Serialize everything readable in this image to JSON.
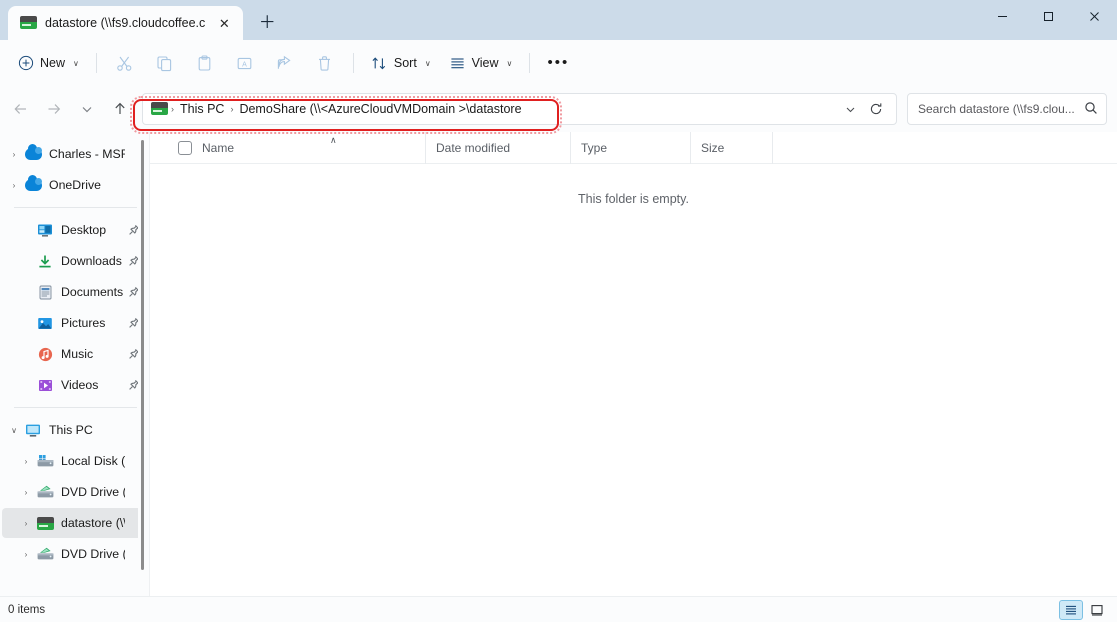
{
  "window": {
    "tab_title": "datastore (\\\\fs9.cloudcoffee.c",
    "tab_icon": "network-drive-icon",
    "close_tab_label": "✕",
    "new_tab_label": "＋",
    "minimize_label": "—",
    "maximize_label": "☐",
    "close_label": "✕"
  },
  "toolbar": {
    "new_label": "New",
    "new_chevron": "∨",
    "cut_label": "Cut",
    "copy_label": "Copy",
    "paste_label": "Paste",
    "rename_label": "Rename",
    "share_label": "Share",
    "delete_label": "Delete",
    "sort_label": "Sort",
    "sort_chevron": "∨",
    "view_label": "View",
    "view_chevron": "∨",
    "more_label": "•••"
  },
  "addressbar": {
    "back_label": "←",
    "forward_label": "→",
    "recent_label": "∨",
    "up_label": "↑",
    "breadcrumb_icon": "network-drive-icon",
    "crumbs": [
      {
        "label": "This PC"
      },
      {
        "label": "DemoShare (\\\\<AzureCloudVMDomain >\\datastore"
      }
    ],
    "separator": "›",
    "dropdown_label": "∨",
    "refresh_label": "↻",
    "search_placeholder": "Search datastore (\\\\fs9.clou...",
    "search_value": "",
    "search_icon": "search-icon",
    "annotation_color": "#e02020"
  },
  "sidebar": {
    "items": [
      {
        "label": "Charles - MSFT",
        "icon": "onedrive-cloud-icon",
        "expander": "›",
        "indent": 0,
        "pinned": false,
        "selected": false
      },
      {
        "label": "OneDrive",
        "icon": "onedrive-cloud-icon",
        "expander": "›",
        "indent": 0,
        "pinned": false,
        "selected": false
      },
      {
        "divider": true
      },
      {
        "label": "Desktop",
        "icon": "desktop-icon",
        "expander": "",
        "indent": 1,
        "pinned": true,
        "selected": false
      },
      {
        "label": "Downloads",
        "icon": "downloads-icon",
        "expander": "",
        "indent": 1,
        "pinned": true,
        "selected": false
      },
      {
        "label": "Documents",
        "icon": "documents-icon",
        "expander": "",
        "indent": 1,
        "pinned": true,
        "selected": false
      },
      {
        "label": "Pictures",
        "icon": "pictures-icon",
        "expander": "",
        "indent": 1,
        "pinned": true,
        "selected": false
      },
      {
        "label": "Music",
        "icon": "music-icon",
        "expander": "",
        "indent": 1,
        "pinned": true,
        "selected": false
      },
      {
        "label": "Videos",
        "icon": "videos-icon",
        "expander": "",
        "indent": 1,
        "pinned": true,
        "selected": false
      },
      {
        "divider": true
      },
      {
        "label": "This PC",
        "icon": "this-pc-icon",
        "expander": "∨",
        "indent": 0,
        "pinned": false,
        "selected": false
      },
      {
        "label": "Local Disk (C:)",
        "icon": "local-disk-icon",
        "expander": "›",
        "indent": 1,
        "pinned": false,
        "selected": false
      },
      {
        "label": "DVD Drive (D:)",
        "icon": "dvd-drive-icon",
        "expander": "›",
        "indent": 1,
        "pinned": false,
        "selected": false
      },
      {
        "label": "datastore (\\\\fs",
        "icon": "network-drive-icon",
        "expander": "›",
        "indent": 1,
        "pinned": false,
        "selected": true
      },
      {
        "label": "DVD Drive (D:)",
        "icon": "dvd-drive-icon",
        "expander": "›",
        "indent": 1,
        "pinned": false,
        "selected": false
      }
    ]
  },
  "filelist": {
    "columns": [
      {
        "label": "Name",
        "sorted": "asc",
        "sort_caret": "∧"
      },
      {
        "label": "Date modified",
        "sorted": ""
      },
      {
        "label": "Type",
        "sorted": ""
      },
      {
        "label": "Size",
        "sorted": ""
      }
    ],
    "rows": [],
    "empty_message": "This folder is empty."
  },
  "statusbar": {
    "item_count": "0 items",
    "details_view_label": "Details view",
    "large_icons_view_label": "Large icons view",
    "active_view": "details"
  }
}
